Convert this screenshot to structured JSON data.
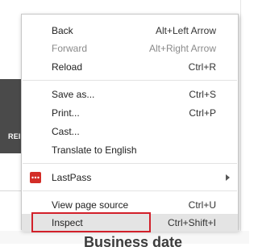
{
  "background": {
    "dark_block_label": "REI",
    "heading": "Business date"
  },
  "menu": {
    "items": [
      {
        "label": "Back",
        "shortcut": "Alt+Left Arrow",
        "enabled": true
      },
      {
        "label": "Forward",
        "shortcut": "Alt+Right Arrow",
        "enabled": false
      },
      {
        "label": "Reload",
        "shortcut": "Ctrl+R",
        "enabled": true
      },
      {
        "label": "Save as...",
        "shortcut": "Ctrl+S",
        "enabled": true
      },
      {
        "label": "Print...",
        "shortcut": "Ctrl+P",
        "enabled": true
      },
      {
        "label": "Cast...",
        "shortcut": "",
        "enabled": true
      },
      {
        "label": "Translate to English",
        "shortcut": "",
        "enabled": true
      },
      {
        "label": "LastPass",
        "shortcut": "",
        "enabled": true,
        "submenu": true,
        "icon": "lastpass-icon"
      },
      {
        "label": "View page source",
        "shortcut": "Ctrl+U",
        "enabled": true
      },
      {
        "label": "Inspect",
        "shortcut": "Ctrl+Shift+I",
        "enabled": true,
        "highlighted": true
      }
    ]
  },
  "colors": {
    "highlight_box": "#d2202a",
    "lastpass_brand": "#d32d27",
    "hover_background": "#e4e4e4"
  }
}
